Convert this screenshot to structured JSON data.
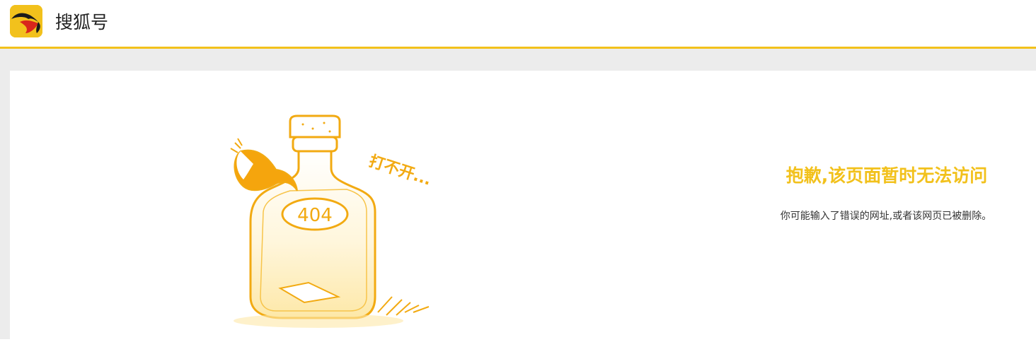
{
  "header": {
    "brand_name": "搜狐号"
  },
  "illustration": {
    "bottle_label": "404",
    "caption": "打不开..."
  },
  "error": {
    "title": "抱歉,该页面暂时无法访问",
    "subtitle": "你可能输入了错误的网址,或者该网页已被删除。"
  },
  "colors": {
    "accent": "#f2c11c",
    "page_background": "#ececec",
    "card_background": "#ffffff"
  },
  "icons": {
    "logo": "sohu-fox-logo-icon",
    "illustration": "fox-tail-bottle-404-illustration"
  }
}
